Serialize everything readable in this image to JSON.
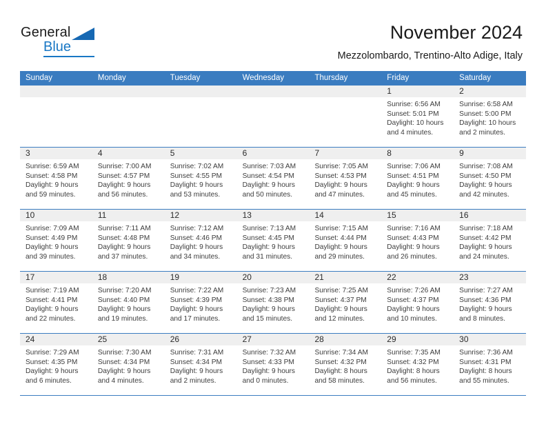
{
  "brand": {
    "name_part1": "General",
    "name_part2": "Blue",
    "accent_color": "#1877c4"
  },
  "header": {
    "title": "November 2024",
    "subtitle": "Mezzolombardo, Trentino-Alto Adige, Italy"
  },
  "calendar": {
    "header_bg": "#3a7cc0",
    "daynum_bg": "#efefef",
    "weekdays": [
      "Sunday",
      "Monday",
      "Tuesday",
      "Wednesday",
      "Thursday",
      "Friday",
      "Saturday"
    ],
    "labels": {
      "sunrise": "Sunrise:",
      "sunset": "Sunset:",
      "daylight": "Daylight:"
    },
    "weeks": [
      [
        {
          "day": "",
          "empty": true
        },
        {
          "day": "",
          "empty": true
        },
        {
          "day": "",
          "empty": true
        },
        {
          "day": "",
          "empty": true
        },
        {
          "day": "",
          "empty": true
        },
        {
          "day": "1",
          "sunrise": "Sunrise: 6:56 AM",
          "sunset": "Sunset: 5:01 PM",
          "daylight_l1": "Daylight: 10 hours",
          "daylight_l2": "and 4 minutes."
        },
        {
          "day": "2",
          "sunrise": "Sunrise: 6:58 AM",
          "sunset": "Sunset: 5:00 PM",
          "daylight_l1": "Daylight: 10 hours",
          "daylight_l2": "and 2 minutes."
        }
      ],
      [
        {
          "day": "3",
          "sunrise": "Sunrise: 6:59 AM",
          "sunset": "Sunset: 4:58 PM",
          "daylight_l1": "Daylight: 9 hours",
          "daylight_l2": "and 59 minutes."
        },
        {
          "day": "4",
          "sunrise": "Sunrise: 7:00 AM",
          "sunset": "Sunset: 4:57 PM",
          "daylight_l1": "Daylight: 9 hours",
          "daylight_l2": "and 56 minutes."
        },
        {
          "day": "5",
          "sunrise": "Sunrise: 7:02 AM",
          "sunset": "Sunset: 4:55 PM",
          "daylight_l1": "Daylight: 9 hours",
          "daylight_l2": "and 53 minutes."
        },
        {
          "day": "6",
          "sunrise": "Sunrise: 7:03 AM",
          "sunset": "Sunset: 4:54 PM",
          "daylight_l1": "Daylight: 9 hours",
          "daylight_l2": "and 50 minutes."
        },
        {
          "day": "7",
          "sunrise": "Sunrise: 7:05 AM",
          "sunset": "Sunset: 4:53 PM",
          "daylight_l1": "Daylight: 9 hours",
          "daylight_l2": "and 47 minutes."
        },
        {
          "day": "8",
          "sunrise": "Sunrise: 7:06 AM",
          "sunset": "Sunset: 4:51 PM",
          "daylight_l1": "Daylight: 9 hours",
          "daylight_l2": "and 45 minutes."
        },
        {
          "day": "9",
          "sunrise": "Sunrise: 7:08 AM",
          "sunset": "Sunset: 4:50 PM",
          "daylight_l1": "Daylight: 9 hours",
          "daylight_l2": "and 42 minutes."
        }
      ],
      [
        {
          "day": "10",
          "sunrise": "Sunrise: 7:09 AM",
          "sunset": "Sunset: 4:49 PM",
          "daylight_l1": "Daylight: 9 hours",
          "daylight_l2": "and 39 minutes."
        },
        {
          "day": "11",
          "sunrise": "Sunrise: 7:11 AM",
          "sunset": "Sunset: 4:48 PM",
          "daylight_l1": "Daylight: 9 hours",
          "daylight_l2": "and 37 minutes."
        },
        {
          "day": "12",
          "sunrise": "Sunrise: 7:12 AM",
          "sunset": "Sunset: 4:46 PM",
          "daylight_l1": "Daylight: 9 hours",
          "daylight_l2": "and 34 minutes."
        },
        {
          "day": "13",
          "sunrise": "Sunrise: 7:13 AM",
          "sunset": "Sunset: 4:45 PM",
          "daylight_l1": "Daylight: 9 hours",
          "daylight_l2": "and 31 minutes."
        },
        {
          "day": "14",
          "sunrise": "Sunrise: 7:15 AM",
          "sunset": "Sunset: 4:44 PM",
          "daylight_l1": "Daylight: 9 hours",
          "daylight_l2": "and 29 minutes."
        },
        {
          "day": "15",
          "sunrise": "Sunrise: 7:16 AM",
          "sunset": "Sunset: 4:43 PM",
          "daylight_l1": "Daylight: 9 hours",
          "daylight_l2": "and 26 minutes."
        },
        {
          "day": "16",
          "sunrise": "Sunrise: 7:18 AM",
          "sunset": "Sunset: 4:42 PM",
          "daylight_l1": "Daylight: 9 hours",
          "daylight_l2": "and 24 minutes."
        }
      ],
      [
        {
          "day": "17",
          "sunrise": "Sunrise: 7:19 AM",
          "sunset": "Sunset: 4:41 PM",
          "daylight_l1": "Daylight: 9 hours",
          "daylight_l2": "and 22 minutes."
        },
        {
          "day": "18",
          "sunrise": "Sunrise: 7:20 AM",
          "sunset": "Sunset: 4:40 PM",
          "daylight_l1": "Daylight: 9 hours",
          "daylight_l2": "and 19 minutes."
        },
        {
          "day": "19",
          "sunrise": "Sunrise: 7:22 AM",
          "sunset": "Sunset: 4:39 PM",
          "daylight_l1": "Daylight: 9 hours",
          "daylight_l2": "and 17 minutes."
        },
        {
          "day": "20",
          "sunrise": "Sunrise: 7:23 AM",
          "sunset": "Sunset: 4:38 PM",
          "daylight_l1": "Daylight: 9 hours",
          "daylight_l2": "and 15 minutes."
        },
        {
          "day": "21",
          "sunrise": "Sunrise: 7:25 AM",
          "sunset": "Sunset: 4:37 PM",
          "daylight_l1": "Daylight: 9 hours",
          "daylight_l2": "and 12 minutes."
        },
        {
          "day": "22",
          "sunrise": "Sunrise: 7:26 AM",
          "sunset": "Sunset: 4:37 PM",
          "daylight_l1": "Daylight: 9 hours",
          "daylight_l2": "and 10 minutes."
        },
        {
          "day": "23",
          "sunrise": "Sunrise: 7:27 AM",
          "sunset": "Sunset: 4:36 PM",
          "daylight_l1": "Daylight: 9 hours",
          "daylight_l2": "and 8 minutes."
        }
      ],
      [
        {
          "day": "24",
          "sunrise": "Sunrise: 7:29 AM",
          "sunset": "Sunset: 4:35 PM",
          "daylight_l1": "Daylight: 9 hours",
          "daylight_l2": "and 6 minutes."
        },
        {
          "day": "25",
          "sunrise": "Sunrise: 7:30 AM",
          "sunset": "Sunset: 4:34 PM",
          "daylight_l1": "Daylight: 9 hours",
          "daylight_l2": "and 4 minutes."
        },
        {
          "day": "26",
          "sunrise": "Sunrise: 7:31 AM",
          "sunset": "Sunset: 4:34 PM",
          "daylight_l1": "Daylight: 9 hours",
          "daylight_l2": "and 2 minutes."
        },
        {
          "day": "27",
          "sunrise": "Sunrise: 7:32 AM",
          "sunset": "Sunset: 4:33 PM",
          "daylight_l1": "Daylight: 9 hours",
          "daylight_l2": "and 0 minutes."
        },
        {
          "day": "28",
          "sunrise": "Sunrise: 7:34 AM",
          "sunset": "Sunset: 4:32 PM",
          "daylight_l1": "Daylight: 8 hours",
          "daylight_l2": "and 58 minutes."
        },
        {
          "day": "29",
          "sunrise": "Sunrise: 7:35 AM",
          "sunset": "Sunset: 4:32 PM",
          "daylight_l1": "Daylight: 8 hours",
          "daylight_l2": "and 56 minutes."
        },
        {
          "day": "30",
          "sunrise": "Sunrise: 7:36 AM",
          "sunset": "Sunset: 4:31 PM",
          "daylight_l1": "Daylight: 8 hours",
          "daylight_l2": "and 55 minutes."
        }
      ]
    ]
  }
}
